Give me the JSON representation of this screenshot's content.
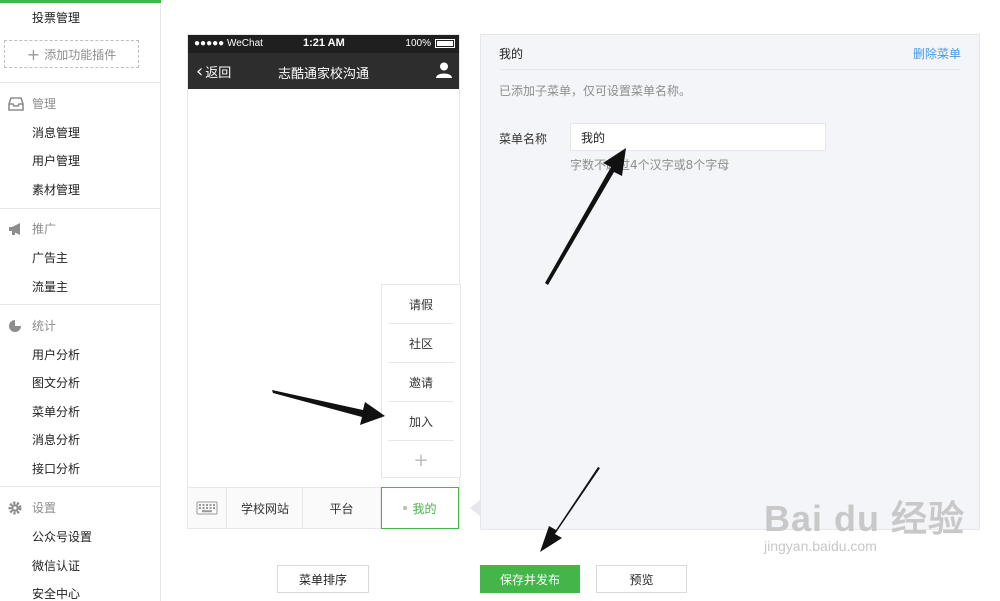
{
  "sidebar": {
    "top_item": "投票管理",
    "add_plugin": "添加功能插件",
    "sections": [
      {
        "title": "管理",
        "icon": "inbox-icon",
        "items": [
          "消息管理",
          "用户管理",
          "素材管理"
        ]
      },
      {
        "title": "推广",
        "icon": "megaphone-icon",
        "items": [
          "广告主",
          "流量主"
        ]
      },
      {
        "title": "统计",
        "icon": "pie-chart-icon",
        "items": [
          "用户分析",
          "图文分析",
          "菜单分析",
          "消息分析",
          "接口分析"
        ]
      },
      {
        "title": "设置",
        "icon": "gear-icon",
        "items": [
          "公众号设置",
          "微信认证",
          "安全中心"
        ]
      }
    ]
  },
  "phone": {
    "status": {
      "carrier": "●●●●● WeChat",
      "time": "1:21 AM",
      "battery": "100%"
    },
    "nav": {
      "back": "返回",
      "title": "志酷通家校沟通"
    },
    "submenu": [
      "请假",
      "社区",
      "邀请",
      "加入",
      "+"
    ],
    "menubar": [
      "学校网站",
      "平台",
      "我的"
    ]
  },
  "panel": {
    "title": "我的",
    "delete": "删除菜单",
    "note": "已添加子菜单，仅可设置菜单名称。",
    "field_label": "菜单名称",
    "field_value": "我的",
    "hint": "字数不超过4个汉字或8个字母"
  },
  "buttons": {
    "sort": "菜单排序",
    "save": "保存并发布",
    "preview": "预览"
  },
  "watermark": {
    "brand": "Bai du 经验",
    "url": "jingyan.baidu.com"
  },
  "colors": {
    "accent": "#44b549",
    "link": "#459ae9"
  }
}
